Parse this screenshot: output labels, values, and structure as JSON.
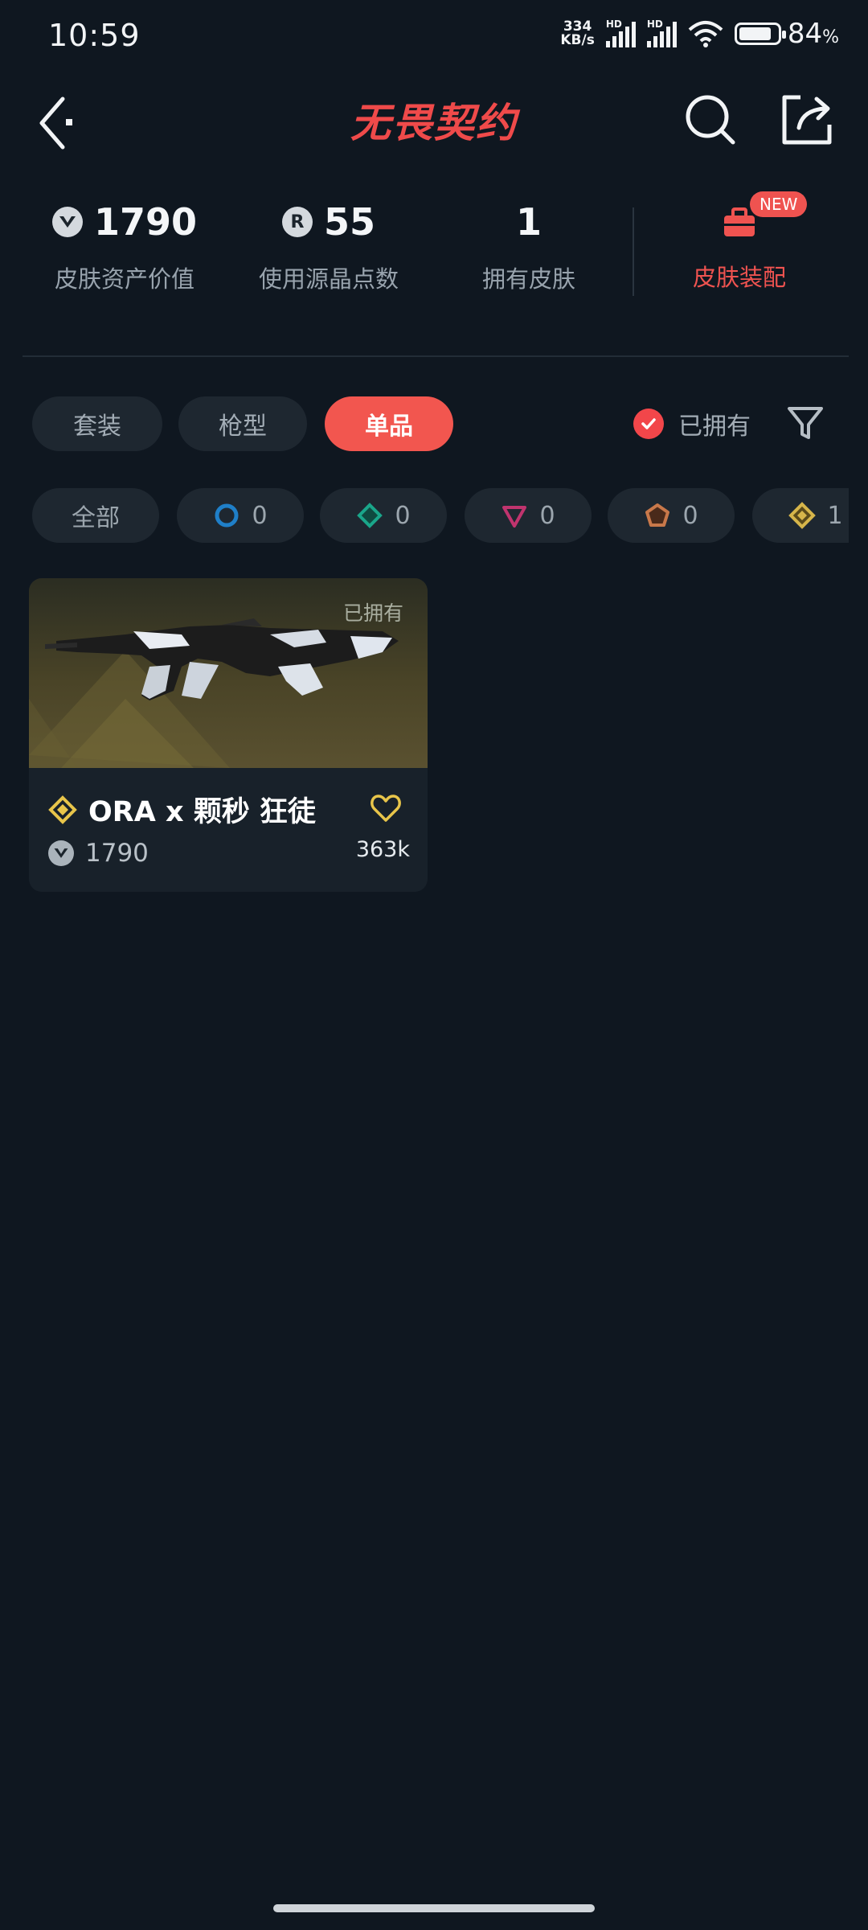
{
  "status_bar": {
    "time": "10:59",
    "net_speed_value": "334",
    "net_speed_unit": "KB/s",
    "sim1": "HD",
    "sim2": "HD",
    "battery_pct": "84",
    "battery_unit": "%",
    "battery_level": 0.84
  },
  "header": {
    "title": "无畏契约",
    "back_icon": "chevron-left-icon",
    "search_icon": "search-icon",
    "share_icon": "share-icon"
  },
  "stats": {
    "asset_value": {
      "value": "1790",
      "label": "皮肤资产价值"
    },
    "points_used": {
      "value": "55",
      "label": "使用源晶点数"
    },
    "skins_owned": {
      "value": "1",
      "label": "拥有皮肤"
    },
    "equip": {
      "label": "皮肤装配",
      "badge": "NEW"
    }
  },
  "tabs": [
    {
      "label": "套装",
      "active": false
    },
    {
      "label": "枪型",
      "active": false
    },
    {
      "label": "单品",
      "active": true
    }
  ],
  "owned_filter": {
    "label": "已拥有",
    "checked": true
  },
  "rarity_chips": [
    {
      "label": "全部"
    },
    {
      "count": "0",
      "color": "#1f7fc8",
      "icon": "rarity-select-icon"
    },
    {
      "count": "0",
      "color": "#1aa68a",
      "icon": "rarity-deluxe-icon"
    },
    {
      "count": "0",
      "color": "#c0346e",
      "icon": "rarity-premium-icon"
    },
    {
      "count": "0",
      "color": "#c8784a",
      "icon": "rarity-exclusive-icon"
    },
    {
      "count": "1",
      "color": "#d6b54a",
      "icon": "rarity-ultra-icon"
    }
  ],
  "items": [
    {
      "owned_label": "已拥有",
      "title": "ORA x 颗秒 狂徒",
      "price": "1790",
      "views": "363k",
      "rarity_color": "#e8c54a"
    }
  ],
  "colors": {
    "background": "#0f1720",
    "accent": "#f2564f"
  }
}
